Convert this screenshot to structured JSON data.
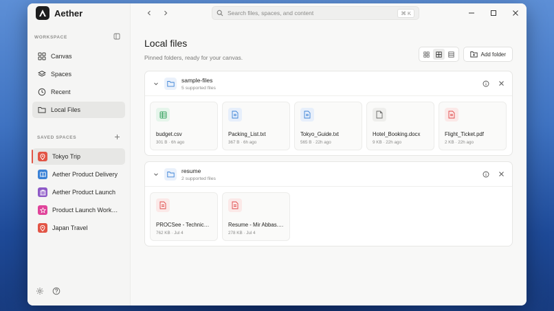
{
  "app": {
    "name": "Aether"
  },
  "search": {
    "placeholder": "Search files, spaces, and content",
    "shortcut": "⌘ K"
  },
  "sidebar": {
    "workspace_label": "WORKSPACE",
    "nav": [
      {
        "label": "Canvas",
        "icon": "grid-icon"
      },
      {
        "label": "Spaces",
        "icon": "layers-icon"
      },
      {
        "label": "Recent",
        "icon": "clock-icon"
      },
      {
        "label": "Local Files",
        "icon": "folder-icon",
        "active": true
      }
    ],
    "saved_label": "SAVED SPACES",
    "spaces": [
      {
        "label": "Tokyo Trip",
        "color": "#e25546",
        "active": true
      },
      {
        "label": "Aether Product Delivery",
        "color": "#3b82d6"
      },
      {
        "label": "Aether Product Launch",
        "color": "#8e5ac7"
      },
      {
        "label": "Product Launch Works...",
        "color": "#e0449a"
      },
      {
        "label": "Japan Travel",
        "color": "#e25546"
      }
    ]
  },
  "main": {
    "title": "Local files",
    "subtitle": "Pinned folders, ready for your canvas.",
    "add_folder_label": "Add folder",
    "folders": [
      {
        "name": "sample-files",
        "count": "5 supported files",
        "files": [
          {
            "name": "budget.csv",
            "meta": "301 B · 6h ago",
            "type": "csv",
            "color": "#2f9e5a",
            "bg": "#e6f5eb"
          },
          {
            "name": "Packing_List.txt",
            "meta": "367 B · 6h ago",
            "type": "txt",
            "color": "#3b82d6",
            "bg": "#e7effb"
          },
          {
            "name": "Tokyo_Guide.txt",
            "meta": "565 B · 22h ago",
            "type": "txt",
            "color": "#3b82d6",
            "bg": "#e7effb"
          },
          {
            "name": "Hotel_Booking.docx",
            "meta": "9 KB · 22h ago",
            "type": "docx",
            "color": "#6b6b69",
            "bg": "#eeeeec"
          },
          {
            "name": "Flight_Ticket.pdf",
            "meta": "2 KB · 22h ago",
            "type": "pdf",
            "color": "#e04848",
            "bg": "#fbe9e8"
          }
        ]
      },
      {
        "name": "resume",
        "count": "2 supported files",
        "files": [
          {
            "name": "PROCSee - Technical ...",
            "meta": "762 KB · Jul 4",
            "type": "pdf",
            "color": "#e04848",
            "bg": "#fbe9e8"
          },
          {
            "name": "Resume - Mir Abbas.pdf",
            "meta": "278 KB · Jul 4",
            "type": "pdf",
            "color": "#e04848",
            "bg": "#fbe9e8"
          }
        ]
      }
    ]
  }
}
